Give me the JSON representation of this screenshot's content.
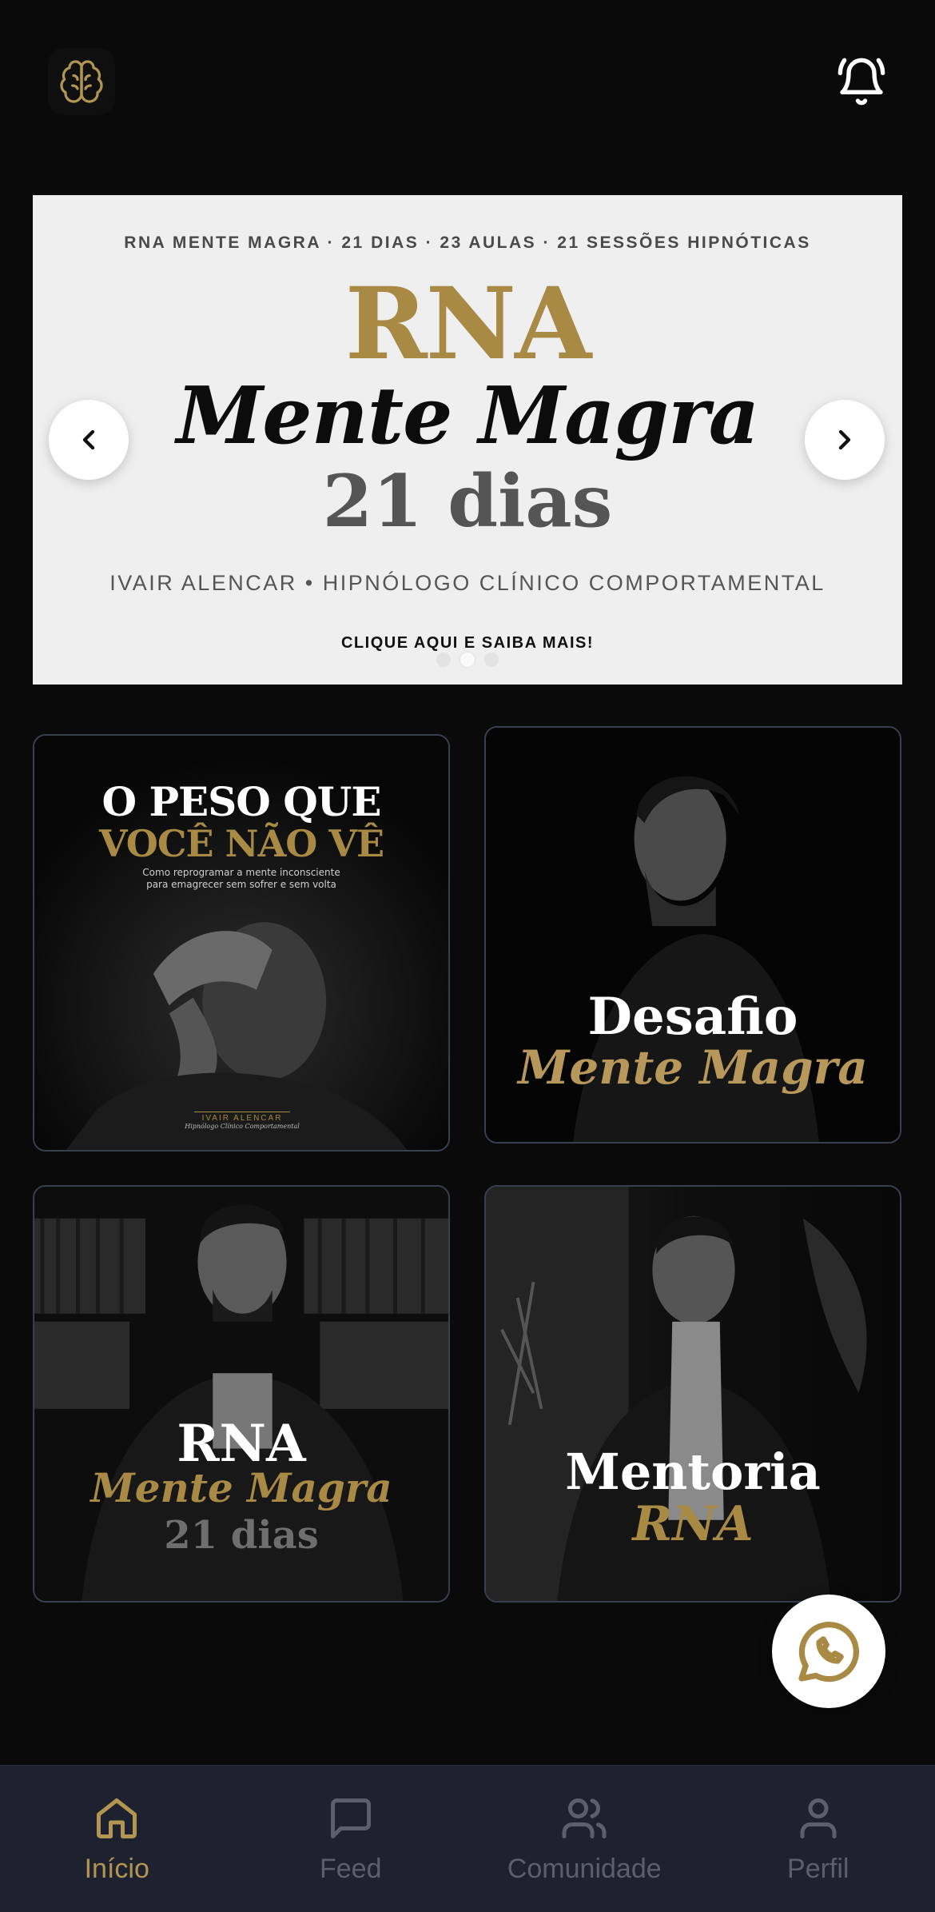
{
  "colors": {
    "background": "#0a0a0b",
    "accent_gold": "#a88a45",
    "tabbar": "#1e2230",
    "inactive": "#5a5f6b"
  },
  "header": {
    "logo_icon": "brain-icon",
    "notification_icon": "bell-icon"
  },
  "banner": {
    "topline": "RNA MENTE MAGRA · 21 DIAS · 23 AULAS · 21 SESSÕES HIPNÓTICAS",
    "title_rna": "RNA",
    "title_mente": "Mente Magra",
    "title_days": "21 dias",
    "author": "IVAIR ALENCAR • HIPNÓLOGO CLÍNICO COMPORTAMENTAL",
    "cta": "CLIQUE AQUI E SAIBA MAIS!",
    "slide_count": 3,
    "active_slide": 2,
    "prev_icon": "chevron-left-icon",
    "next_icon": "chevron-right-icon"
  },
  "cards": [
    {
      "line1": "O PESO QUE",
      "line2": "VOCÊ NÃO VÊ",
      "subtitle": "Como reprogramar a mente inconsciente para emagrecer sem sofrer e sem volta",
      "signature": "IVAIR ALENCAR",
      "signature_sub": "Hipnólogo Clínico Comportamental"
    },
    {
      "line1": "Desafio",
      "line2": "Mente Magra"
    },
    {
      "line1": "RNA",
      "line2": "Mente Magra",
      "line3": "21 dias"
    },
    {
      "line1": "Mentoria",
      "line2": "RNA"
    }
  ],
  "fab": {
    "icon": "whatsapp-icon"
  },
  "tabbar": {
    "active": "Início",
    "items": [
      {
        "label": "Início",
        "icon": "home-icon"
      },
      {
        "label": "Feed",
        "icon": "message-square-icon"
      },
      {
        "label": "Comunidade",
        "icon": "users-icon"
      },
      {
        "label": "Perfil",
        "icon": "user-icon"
      }
    ]
  }
}
